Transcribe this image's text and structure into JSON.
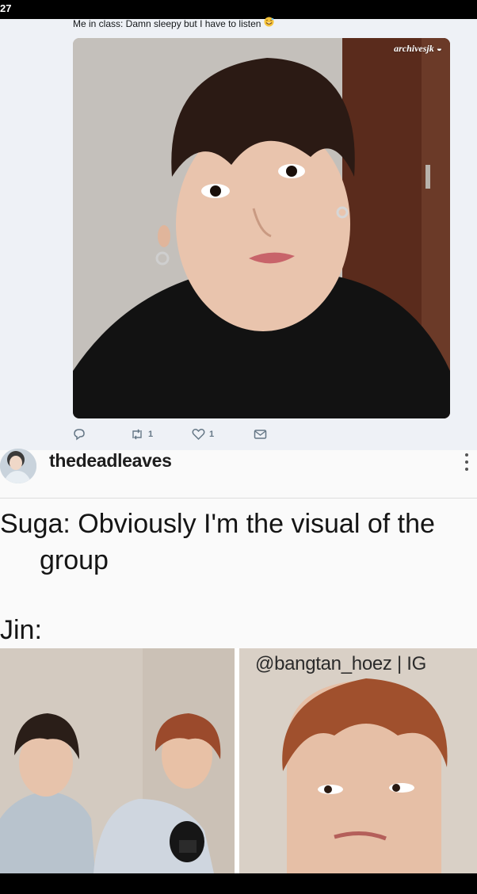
{
  "status_bar": {
    "time": "27"
  },
  "tweet": {
    "text": "Me in class: Damn sleepy but I have to listen",
    "emoji": "sweat-smile-emoji",
    "watermark": "archivesjk",
    "actions": {
      "reply_count": "",
      "retweet_count": "1",
      "like_count": "1"
    }
  },
  "post": {
    "username": "thedeadleaves",
    "caption_line1": "Suga: Obviously I'm the visual of the",
    "caption_line2": "group",
    "jin_label": "Jin:",
    "ig_handle": "@bangtan_hoez | IG"
  },
  "colors": {
    "tweet_bg": "#eef1f6",
    "icon_gray": "#657786",
    "post_bg": "#fafafa"
  }
}
